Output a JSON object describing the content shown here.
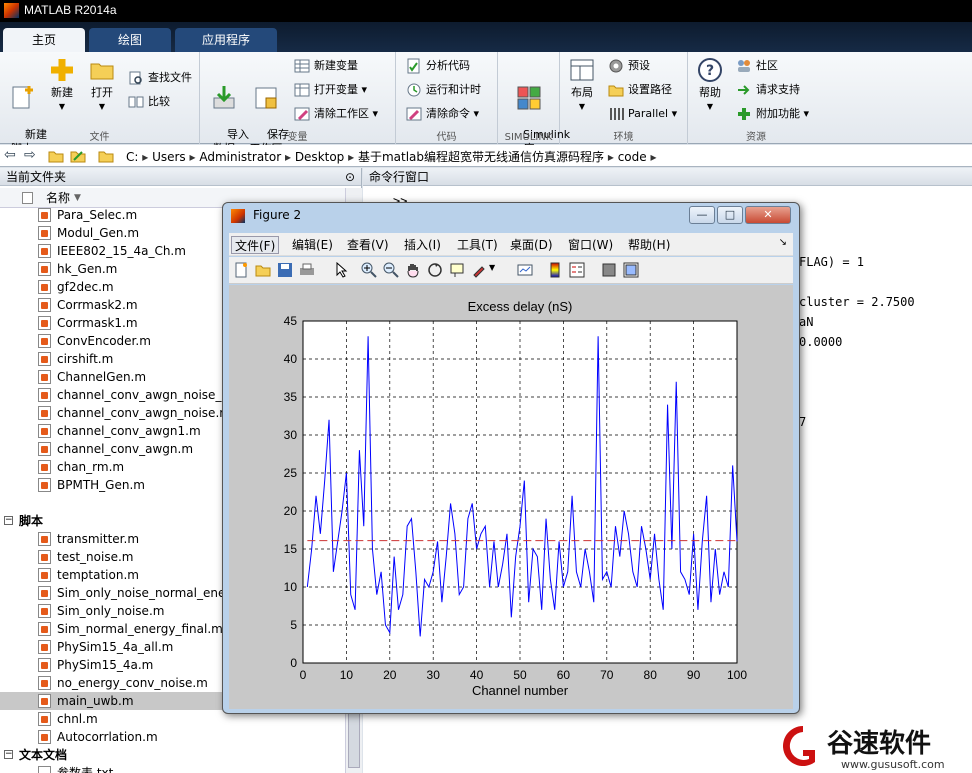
{
  "app": {
    "title": "MATLAB R2014a"
  },
  "tabs": [
    {
      "label": "主页"
    },
    {
      "label": "绘图"
    },
    {
      "label": "应用程序"
    }
  ],
  "ribbon": {
    "groups": {
      "file": "文件",
      "variable": "变量",
      "code": "代码",
      "simulink": "SIMULINK",
      "environment": "环境",
      "resources": "资源"
    },
    "new_script": "新建\n脚本",
    "new": "新建",
    "open": "打开",
    "find_files": "查找文件",
    "compare": "比较",
    "import_data": "导入\n数据",
    "save_workspace": "保存\n工作区",
    "new_variable": "新建变量",
    "open_variable": "打开变量",
    "clear_workspace": "清除工作区",
    "analyze_code": "分析代码",
    "run_and_time": "运行和计时",
    "clear_commands": "清除命令",
    "simulink_library": "Simulink\n库",
    "layout": "布局",
    "preferences": "预设",
    "set_path": "设置路径",
    "parallel": "Parallel",
    "help": "帮助",
    "community": "社区",
    "request_support": "请求支持",
    "add_ons": "附加功能"
  },
  "address": {
    "segments": [
      "C:",
      "Users",
      "Administrator",
      "Desktop",
      "基于matlab编程超宽带无线通信仿真源码程序",
      "code"
    ]
  },
  "current_folder": {
    "title": "当前文件夹",
    "name_header": "名称",
    "files": [
      {
        "name": "Para_Selec.m",
        "type": "m"
      },
      {
        "name": "Modul_Gen.m",
        "type": "m"
      },
      {
        "name": "IEEE802_15_4a_Ch.m",
        "type": "m"
      },
      {
        "name": "hk_Gen.m",
        "type": "m"
      },
      {
        "name": "gf2dec.m",
        "type": "m"
      },
      {
        "name": "Corrmask2.m",
        "type": "m"
      },
      {
        "name": "Corrmask1.m",
        "type": "m"
      },
      {
        "name": "ConvEncoder.m",
        "type": "m"
      },
      {
        "name": "cirshift.m",
        "type": "m"
      },
      {
        "name": "ChannelGen.m",
        "type": "m"
      },
      {
        "name": "channel_conv_awgn_noise_no",
        "type": "m"
      },
      {
        "name": "channel_conv_awgn_noise.m",
        "type": "m"
      },
      {
        "name": "channel_conv_awgn1.m",
        "type": "m"
      },
      {
        "name": "channel_conv_awgn.m",
        "type": "m"
      },
      {
        "name": "chan_rm.m",
        "type": "m"
      },
      {
        "name": "BPMTH_Gen.m",
        "type": "m"
      },
      {
        "name": "",
        "type": "gap"
      },
      {
        "name": "脚本",
        "type": "cat"
      },
      {
        "name": "transmitter.m",
        "type": "m"
      },
      {
        "name": "test_noise.m",
        "type": "m"
      },
      {
        "name": "temptation.m",
        "type": "m"
      },
      {
        "name": "Sim_only_noise_normal_energ",
        "type": "m"
      },
      {
        "name": "Sim_only_noise.m",
        "type": "m"
      },
      {
        "name": "Sim_normal_energy_final.m",
        "type": "m"
      },
      {
        "name": "PhySim15_4a_all.m",
        "type": "m"
      },
      {
        "name": "PhySim15_4a.m",
        "type": "m"
      },
      {
        "name": "no_energy_conv_noise.m",
        "type": "m"
      },
      {
        "name": "main_uwb.m",
        "type": "m",
        "selected": true
      },
      {
        "name": "chnl.m",
        "type": "m"
      },
      {
        "name": "Autocorrlation.m",
        "type": "m"
      },
      {
        "name": "文本文档",
        "type": "cat"
      },
      {
        "name": "参数表.txt",
        "type": "txt"
      }
    ]
  },
  "command_window": {
    "title": "命令行窗口",
    "lines": [
      ">>",
      "FLAG) = 1",
      "cluster = 2.7500",
      "aN",
      "0.0000",
      "7"
    ]
  },
  "figure": {
    "title": "Figure 2",
    "menus": [
      "文件(F)",
      "编辑(E)",
      "查看(V)",
      "插入(I)",
      "工具(T)",
      "桌面(D)",
      "窗口(W)",
      "帮助(H)"
    ],
    "window_buttons": {
      "minimize": "—",
      "maximize": "□",
      "close": "✕"
    }
  },
  "chart_data": {
    "type": "line",
    "title": "Excess delay (nS)",
    "xlabel": "Channel number",
    "ylabel": "",
    "xlim": [
      0,
      100
    ],
    "ylim": [
      0,
      45
    ],
    "xticks": [
      0,
      10,
      20,
      30,
      40,
      50,
      60,
      70,
      80,
      90,
      100
    ],
    "yticks": [
      0,
      5,
      10,
      15,
      20,
      25,
      30,
      35,
      40,
      45
    ],
    "grid": true,
    "series": [
      {
        "color": "#0000ff",
        "style": "solid",
        "x": [
          1,
          2,
          3,
          4,
          5,
          6,
          7,
          8,
          9,
          10,
          11,
          12,
          13,
          14,
          15,
          16,
          17,
          18,
          19,
          20,
          21,
          22,
          23,
          24,
          25,
          26,
          27,
          28,
          29,
          30,
          31,
          32,
          33,
          34,
          35,
          36,
          37,
          38,
          39,
          40,
          41,
          42,
          43,
          44,
          45,
          46,
          47,
          48,
          49,
          50,
          51,
          52,
          53,
          54,
          55,
          56,
          57,
          58,
          59,
          60,
          61,
          62,
          63,
          64,
          65,
          66,
          67,
          68,
          69,
          70,
          71,
          72,
          73,
          74,
          75,
          76,
          77,
          78,
          79,
          80,
          81,
          82,
          83,
          84,
          85,
          86,
          87,
          88,
          89,
          90,
          91,
          92,
          93,
          94,
          95,
          96,
          97,
          98,
          99,
          100
        ],
        "y": [
          10,
          15,
          22,
          17,
          24,
          32,
          12,
          16,
          20,
          25,
          9,
          7,
          28,
          18,
          43,
          15,
          9,
          12,
          5,
          4,
          14,
          7,
          9,
          18,
          19,
          12,
          3.5,
          11,
          10,
          12,
          16,
          8,
          14,
          21,
          17,
          9,
          10,
          19,
          21,
          15,
          17,
          18,
          10,
          16,
          10,
          13,
          17,
          6,
          14,
          18,
          24,
          8,
          15,
          14,
          7,
          19,
          11,
          7,
          16,
          10,
          12,
          22,
          12,
          10,
          15,
          12,
          8,
          43,
          11,
          12,
          10,
          18,
          14,
          20,
          17,
          12,
          10,
          18,
          15,
          11,
          17,
          11,
          7,
          34,
          15,
          37,
          12,
          11,
          9,
          17,
          7,
          16,
          22,
          8,
          15,
          9,
          12,
          10,
          26,
          16
        ]
      },
      {
        "color": "#cc3333",
        "style": "dashed",
        "x": [
          1,
          100
        ],
        "y": [
          16.1,
          16.1
        ]
      }
    ]
  }
}
